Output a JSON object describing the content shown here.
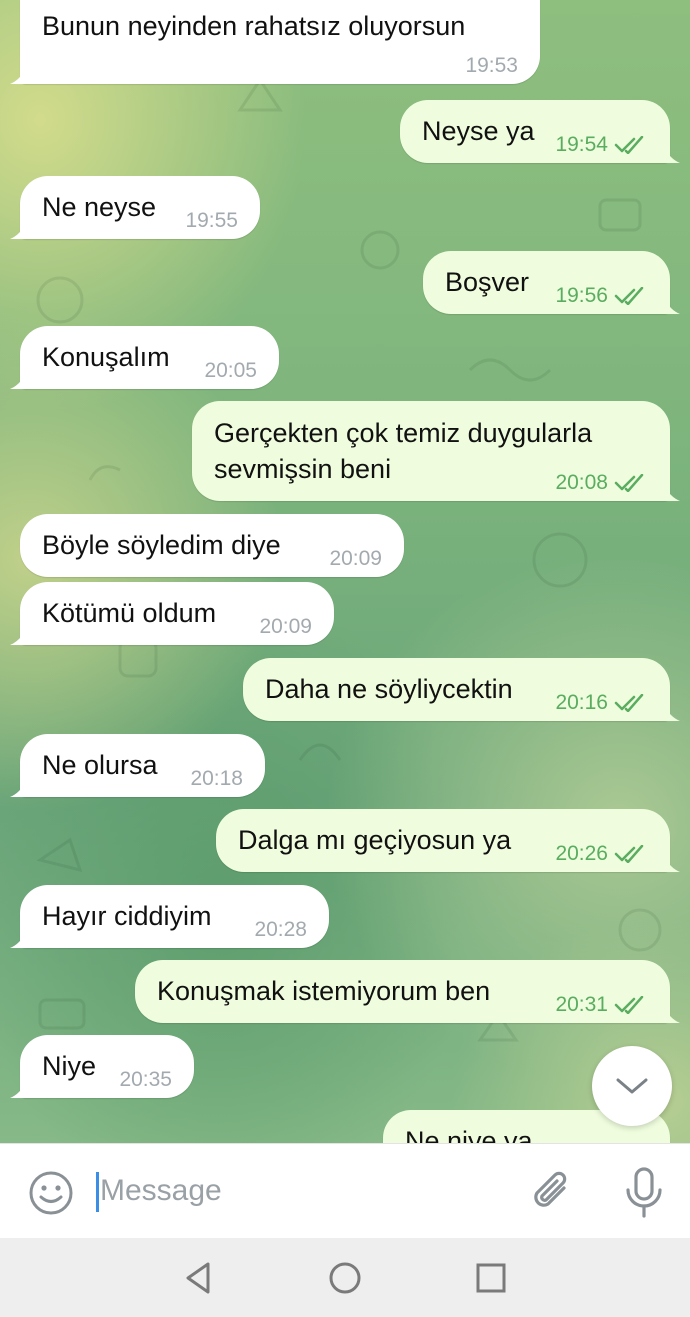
{
  "chat": {
    "messages": [
      {
        "text": "Bunun neyinden rahatsız oluyorsun",
        "time": "19:53",
        "direction": "in"
      },
      {
        "text": "Neyse ya",
        "time": "19:54",
        "direction": "out",
        "read": true
      },
      {
        "text": "Ne neyse",
        "time": "19:55",
        "direction": "in"
      },
      {
        "text": "Boşver",
        "time": "19:56",
        "direction": "out",
        "read": true
      },
      {
        "text": "Konuşalım",
        "time": "20:05",
        "direction": "in"
      },
      {
        "text": "Gerçekten çok temiz duygularla sevmişsin beni",
        "time": "20:08",
        "direction": "out",
        "read": true
      },
      {
        "text": "Böyle söyledim diye",
        "time": "20:09",
        "direction": "in"
      },
      {
        "text": "Kötümü oldum",
        "time": "20:09",
        "direction": "in"
      },
      {
        "text": "Daha ne söyliycektin",
        "time": "20:16",
        "direction": "out",
        "read": true
      },
      {
        "text": "Ne olursa",
        "time": "20:18",
        "direction": "in"
      },
      {
        "text": "Dalga mı geçiyosun ya",
        "time": "20:26",
        "direction": "out",
        "read": true
      },
      {
        "text": "Hayır ciddiyim",
        "time": "20:28",
        "direction": "in"
      },
      {
        "text": "Konuşmak istemiyorum ben",
        "time": "20:31",
        "direction": "out",
        "read": true
      },
      {
        "text": "Niye",
        "time": "20:35",
        "direction": "in"
      },
      {
        "text": "Ne niye ya",
        "time": "",
        "direction": "out",
        "partial": true
      }
    ]
  },
  "input": {
    "placeholder": "Message",
    "value": ""
  },
  "icons": {
    "emoji": "smile-icon",
    "attach": "paperclip-icon",
    "mic": "microphone-icon",
    "scroll_down": "chevron-down-icon",
    "read_receipt": "double-check-icon",
    "nav_back": "triangle-back-icon",
    "nav_home": "circle-home-icon",
    "nav_recents": "square-recents-icon"
  },
  "colors": {
    "incoming_bubble": "#ffffff",
    "outgoing_bubble": "#effdde",
    "outgoing_meta": "#5aad60",
    "incoming_meta": "#a3aaaf",
    "caret": "#3a8ee6"
  }
}
